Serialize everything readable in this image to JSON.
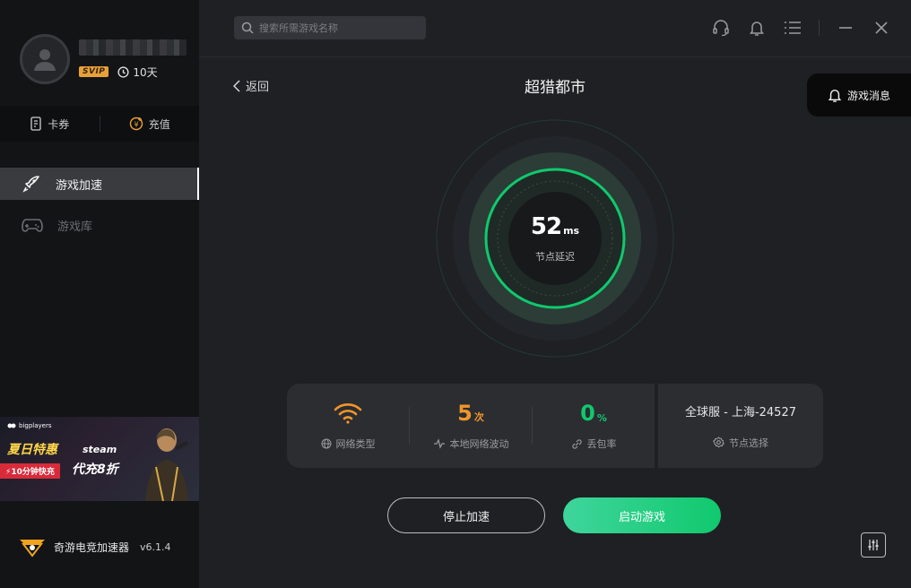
{
  "user": {
    "badge": "SVIP",
    "days": "10天"
  },
  "wallet": {
    "coupon": "卡券",
    "recharge": "充值"
  },
  "nav": {
    "items": [
      {
        "label": "游戏加速"
      },
      {
        "label": "游戏库"
      }
    ]
  },
  "banner": {
    "brand": "bigplayers",
    "title": "夏日特惠",
    "steam": "steam",
    "promo": "⚡10分钟快充",
    "discount": "代充8折"
  },
  "app": {
    "name": "奇游电竞加速器",
    "version": "v6.1.4"
  },
  "search": {
    "placeholder": "搜索所需游戏名称"
  },
  "header": {
    "back": "返回",
    "game_title": "超猎都市",
    "messages": "游戏消息"
  },
  "latency": {
    "value": "52",
    "unit": "ms",
    "label": "节点延迟"
  },
  "stats": {
    "network_type": {
      "label": "网络类型"
    },
    "fluctuation": {
      "value": "5",
      "suffix": "次",
      "label": "本地网络波动",
      "color": "#f0962a"
    },
    "packet_loss": {
      "value": "0",
      "suffix": "%",
      "label": "丢包率",
      "color": "#10c96d"
    },
    "node": {
      "server": "全球服 - 上海-24527",
      "label": "节点选择"
    }
  },
  "actions": {
    "stop": "停止加速",
    "start": "启动游戏"
  },
  "colors": {
    "accent_green": "#10c96d",
    "accent_orange": "#f0962a",
    "sidebar_bg": "#131416",
    "main_bg": "#1f2023"
  }
}
